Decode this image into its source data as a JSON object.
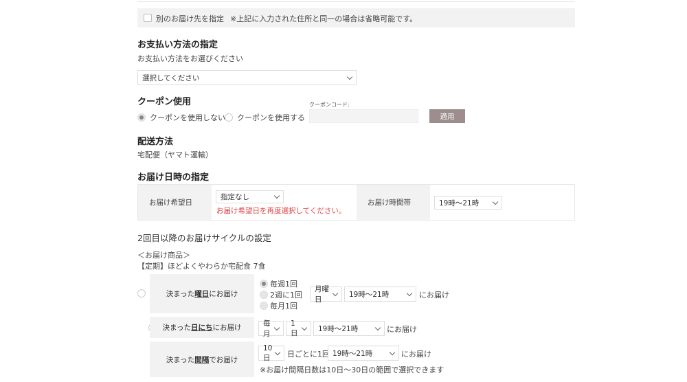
{
  "address": {
    "checkbox_label": "別のお届け先を指定",
    "note": "※上記に入力された住所と同一の場合は省略可能です。"
  },
  "payment": {
    "title": "お支払い方法の指定",
    "subtitle": "お支払い方法をお選びください",
    "select_value": "選択してください"
  },
  "coupon": {
    "title": "クーポン使用",
    "option_no": "クーポンを使用しない",
    "option_yes": "クーポンを使用する",
    "code_label": "クーポンコード:",
    "apply_label": "適用"
  },
  "shipping": {
    "title": "配送方法",
    "method": "宅配便（ヤマト運輸）"
  },
  "delivery": {
    "title": "お届け日時の指定",
    "date_label": "お届け希望日",
    "date_value": "指定なし",
    "date_error": "お届け希望日を再度選択してください。",
    "time_label": "お届け時間帯",
    "time_value": "19時〜21時"
  },
  "cycle": {
    "title": "2回目以降のお届けサイクルの設定",
    "products_label": "＜お届け商品＞",
    "product_name": "【定期】ほどよくやわらか宅配食 7食",
    "row1": {
      "label_pre": "決まった",
      "label_em": "曜日",
      "label_post": "にお届け",
      "freq_weekly": "毎週1回",
      "freq_biweekly": "2週に1回",
      "freq_monthly": "毎月1回",
      "day_value": "月曜日",
      "time_value": "19時〜21時",
      "suffix": "にお届け"
    },
    "row2": {
      "label_pre": "決まった",
      "label_em": "日にち",
      "label_post": "にお届け",
      "month_value": "毎月",
      "day_value": "1日",
      "time_value": "19時〜21時",
      "suffix": "にお届け"
    },
    "row3": {
      "label_pre": "決まった",
      "label_em": "間隔",
      "label_post": "でお届け",
      "interval_value": "10日",
      "interval_text": "日ごとに1回",
      "time_value": "19時〜21時",
      "suffix": "にお届け",
      "note": "※お届け間隔日数は10日〜30日の範囲で選択できます"
    }
  }
}
